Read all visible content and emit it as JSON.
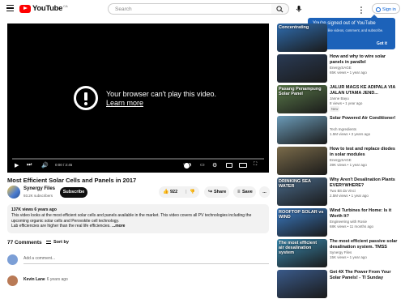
{
  "header": {
    "logo_text": "YouTube",
    "logo_country": "CA",
    "search_placeholder": "Search",
    "signin_label": "Sign in"
  },
  "signin_tip": {
    "title": "You're signed out of YouTube",
    "body": "Sign in to like videos, comment, and subscribe.",
    "ok": "Got it"
  },
  "player": {
    "error_text": "Your browser can't play this video.",
    "learn_more": "Learn more",
    "time": "0:00 / 2:45"
  },
  "video": {
    "title": "Most Efficient Solar Cells and Panels in 2017",
    "channel": "Synergy Files",
    "subscribers": "93.2K subscribers",
    "subscribe": "Subscribe",
    "likes": "922",
    "share": "Share",
    "save": "Save",
    "more": "..."
  },
  "description": {
    "meta": "137K views 6 years ago",
    "line1": "This video looks at the most efficient solar cells and panels available in the market.  This video covers all PV technologies including the",
    "line2": "upcoming organic solar cells and Perovskite cell technology.",
    "line3": "Lab efficiencies are higher than the real life efficiencies. ",
    "more": "...more"
  },
  "comments": {
    "count": "77 Comments",
    "sort": "Sort by",
    "add_placeholder": "Add a comment...",
    "first_author": "Kevin Lane",
    "first_time": "6 years ago"
  },
  "sidebar": [
    {
      "thumb_label": "Concentrating",
      "title": "Concentrating...",
      "channel": "",
      "meta": "",
      "thumb_color": "#2f6db0"
    },
    {
      "thumb_label": "",
      "title": "How and why to wire solar panels in parallel",
      "channel": "EnergySAGE",
      "meta": "65K views • 1 year ago",
      "thumb_color": "#2a3b55"
    },
    {
      "thumb_label": "Pasang Penampung\nSolar Panel",
      "title": "JALUR MAGS KE ADIPALA VIA JALAN UTAMA JEND...",
      "channel": "Janne Bayu",
      "meta": "8 views • 1 year ago",
      "badge": "New",
      "thumb_color": "#5a7a4a"
    },
    {
      "thumb_label": "",
      "title": "Solar Powered Air Conditioner!",
      "channel": "Tech Ingredients",
      "meta": "1.5M views • 3 years ago",
      "thumb_color": "#6b9bb8"
    },
    {
      "thumb_label": "",
      "title": "How to test and replace diodes in solar modules",
      "channel": "EnergySAGE",
      "meta": "39K views • 1 year ago",
      "thumb_color": "#7a6b4a"
    },
    {
      "thumb_label": "DRINKING SEA WATER",
      "title": "Why Aren't Desalination Plants EVERYWHERE?",
      "channel": "Two Bit da Vinci",
      "meta": "2.5M views • 1 year ago",
      "thumb_color": "#4a6a8a"
    },
    {
      "thumb_label": "ROOFTOP SOLAR vs WIND",
      "title": "Wind Turbines for Home: Is it Worth It?",
      "channel": "Engineering with Rosie",
      "meta": "68K views • 11 months ago",
      "thumb_color": "#3a7ac2"
    },
    {
      "thumb_label": "The most efficient\nair desalination system",
      "title": "The most efficient passive solar desalination system. TMSS",
      "channel": "Synergy Files",
      "meta": "15K views • 1 year ago",
      "thumb_color": "#3a8ab0"
    },
    {
      "thumb_label": "",
      "title": "Get 4X The Power From Your Solar Panels! - Tl Sunday",
      "channel": "",
      "meta": "",
      "thumb_color": "#3a5a8a"
    }
  ]
}
